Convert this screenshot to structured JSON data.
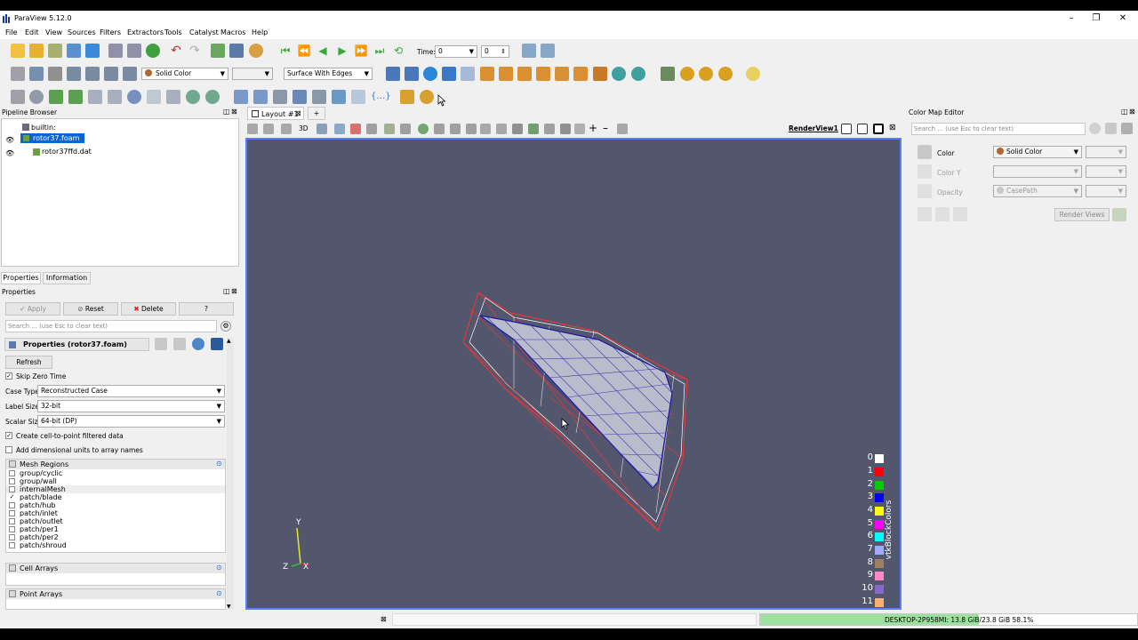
{
  "app": {
    "title": "ParaView 5.12.0"
  },
  "menu": [
    "File",
    "Edit",
    "View",
    "Sources",
    "Filters",
    "Extractors",
    "Tools",
    "Catalyst",
    "Macros",
    "Help"
  ],
  "time_toolbar": {
    "time_label": "Time:",
    "time_value": "0",
    "step_value": "0"
  },
  "display_toolbar": {
    "coloring": "Solid Color",
    "representation": "Surface With Edges"
  },
  "pipeline": {
    "title": "Pipeline Browser",
    "items": [
      "builtin:",
      "rotor37.foam",
      "rotor37ffd.dat"
    ]
  },
  "properties": {
    "tabs": [
      "Properties",
      "Information"
    ],
    "title": "Properties",
    "apply": "Apply",
    "reset": "Reset",
    "delete": "Delete",
    "help": "?",
    "search_placeholder": "Search ... (use Esc to clear text)",
    "section_title": "Properties (rotor37.foam)",
    "refresh": "Refresh",
    "skip_zero_time": "Skip Zero Time",
    "case_type_label": "Case Type",
    "case_type": "Reconstructed Case",
    "label_size_label": "Label Size",
    "label_size": "32-bit",
    "scalar_size_label": "Scalar Size",
    "scalar_size": "64-bit (DP)",
    "create_cell_to_point": "Create cell-to-point filtered data",
    "add_dim_units": "Add dimensional units to array names",
    "mesh_regions_title": "Mesh Regions",
    "mesh_regions": [
      {
        "name": "group/cyclic",
        "checked": false
      },
      {
        "name": "group/wall",
        "checked": false
      },
      {
        "name": "internalMesh",
        "checked": false
      },
      {
        "name": "patch/blade",
        "checked": true
      },
      {
        "name": "patch/hub",
        "checked": false
      },
      {
        "name": "patch/inlet",
        "checked": false
      },
      {
        "name": "patch/outlet",
        "checked": false
      },
      {
        "name": "patch/per1",
        "checked": false
      },
      {
        "name": "patch/per2",
        "checked": false
      },
      {
        "name": "patch/shroud",
        "checked": false
      }
    ],
    "cell_arrays_title": "Cell Arrays",
    "point_arrays_title": "Point Arrays"
  },
  "layout": {
    "tab_label": "Layout #1",
    "add_tab": "+",
    "view_name": "RenderView1",
    "mode_3d": "3D"
  },
  "legend": {
    "title": "vtkBlockColors",
    "entries": [
      {
        "label": "0",
        "color": "#ffffff"
      },
      {
        "label": "1",
        "color": "#ff0000"
      },
      {
        "label": "2",
        "color": "#00cc00"
      },
      {
        "label": "3",
        "color": "#0000ff"
      },
      {
        "label": "4",
        "color": "#ffff00"
      },
      {
        "label": "5",
        "color": "#ff00ff"
      },
      {
        "label": "6",
        "color": "#00ffff"
      },
      {
        "label": "7",
        "color": "#a0a8ff"
      },
      {
        "label": "8",
        "color": "#a08060"
      },
      {
        "label": "9",
        "color": "#ff88c8"
      },
      {
        "label": "10",
        "color": "#8868c8"
      },
      {
        "label": "11",
        "color": "#ffb070"
      }
    ]
  },
  "axes": {
    "y": "Y",
    "z": "Z",
    "x": "X"
  },
  "colormap": {
    "title": "Color Map Editor",
    "search_placeholder": "Search ... (use Esc to clear text)",
    "color_label": "Color",
    "color_value": "Solid Color",
    "color_y_label": "Color Y",
    "opacity_label": "Opacity",
    "opacity_value": "CasePath",
    "render_views": "Render Views"
  },
  "status": {
    "memory": "DESKTOP-2P958MI: 13.8 GiB/23.8 GiB 58.1%",
    "memory_fraction": 0.58
  },
  "colors": {
    "render_bg": "#52576e",
    "selection": "#0a64d2",
    "active_border": "#5a80ff"
  }
}
